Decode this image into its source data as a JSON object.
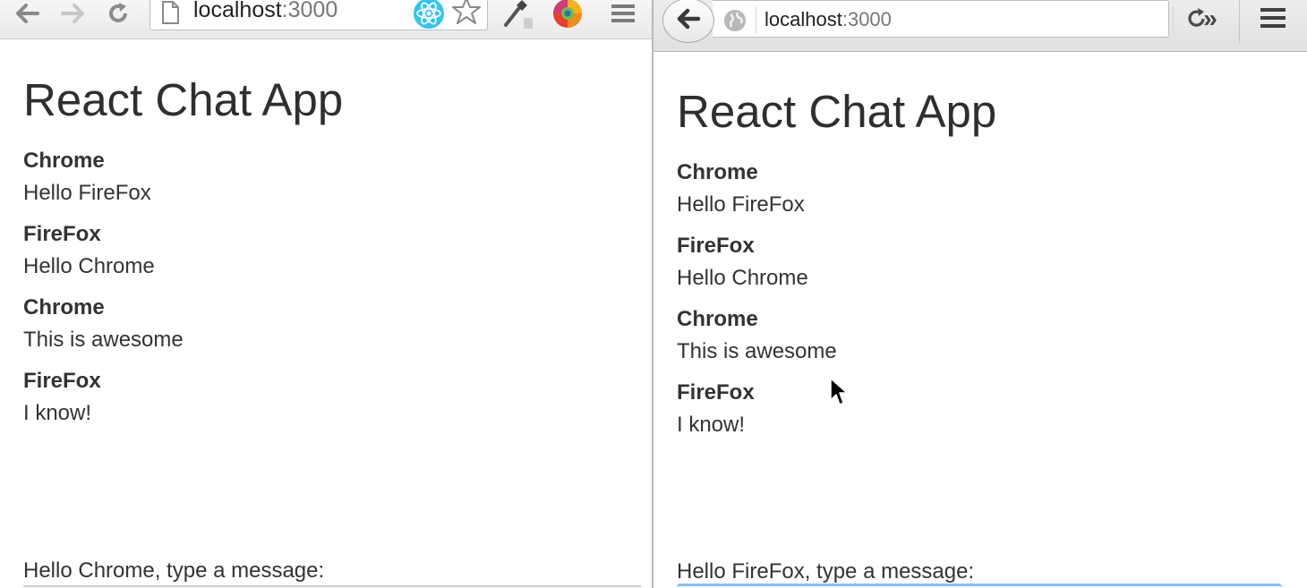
{
  "left_window": {
    "browser": "Chrome",
    "toolbar": {
      "url_host": "localhost",
      "url_port": ":3000",
      "icons": [
        "back-arrow-icon",
        "forward-arrow-icon",
        "reload-icon",
        "page-icon",
        "react-devtools-icon",
        "star-icon",
        "eyedropper-icon",
        "color-wheel-icon",
        "hamburger-menu-icon"
      ]
    },
    "page": {
      "title": "React Chat App",
      "messages": [
        {
          "author": "Chrome",
          "text": "Hello FireFox"
        },
        {
          "author": "FireFox",
          "text": "Hello Chrome"
        },
        {
          "author": "Chrome",
          "text": "This is awesome"
        },
        {
          "author": "FireFox",
          "text": "I know!"
        }
      ],
      "input_label": "Hello Chrome, type a message:"
    }
  },
  "right_window": {
    "browser": "FireFox",
    "toolbar": {
      "url_host": "localhost",
      "url_port": ":3000",
      "overflow_label": "»",
      "icons": [
        "back-arrow-icon",
        "globe-icon",
        "reload-icon",
        "overflow-chevron-icon",
        "hamburger-menu-icon"
      ]
    },
    "page": {
      "title": "React Chat App",
      "messages": [
        {
          "author": "Chrome",
          "text": "Hello FireFox"
        },
        {
          "author": "FireFox",
          "text": "Hello Chrome"
        },
        {
          "author": "Chrome",
          "text": "This is awesome"
        },
        {
          "author": "FireFox",
          "text": "I know!"
        }
      ],
      "input_label": "Hello FireFox, type a message:"
    }
  },
  "colors": {
    "text": "#333333",
    "toolbar_bg": "#e9e9e9",
    "react_blue": "#35c3f0",
    "focus_blue": "#88bdf0"
  }
}
